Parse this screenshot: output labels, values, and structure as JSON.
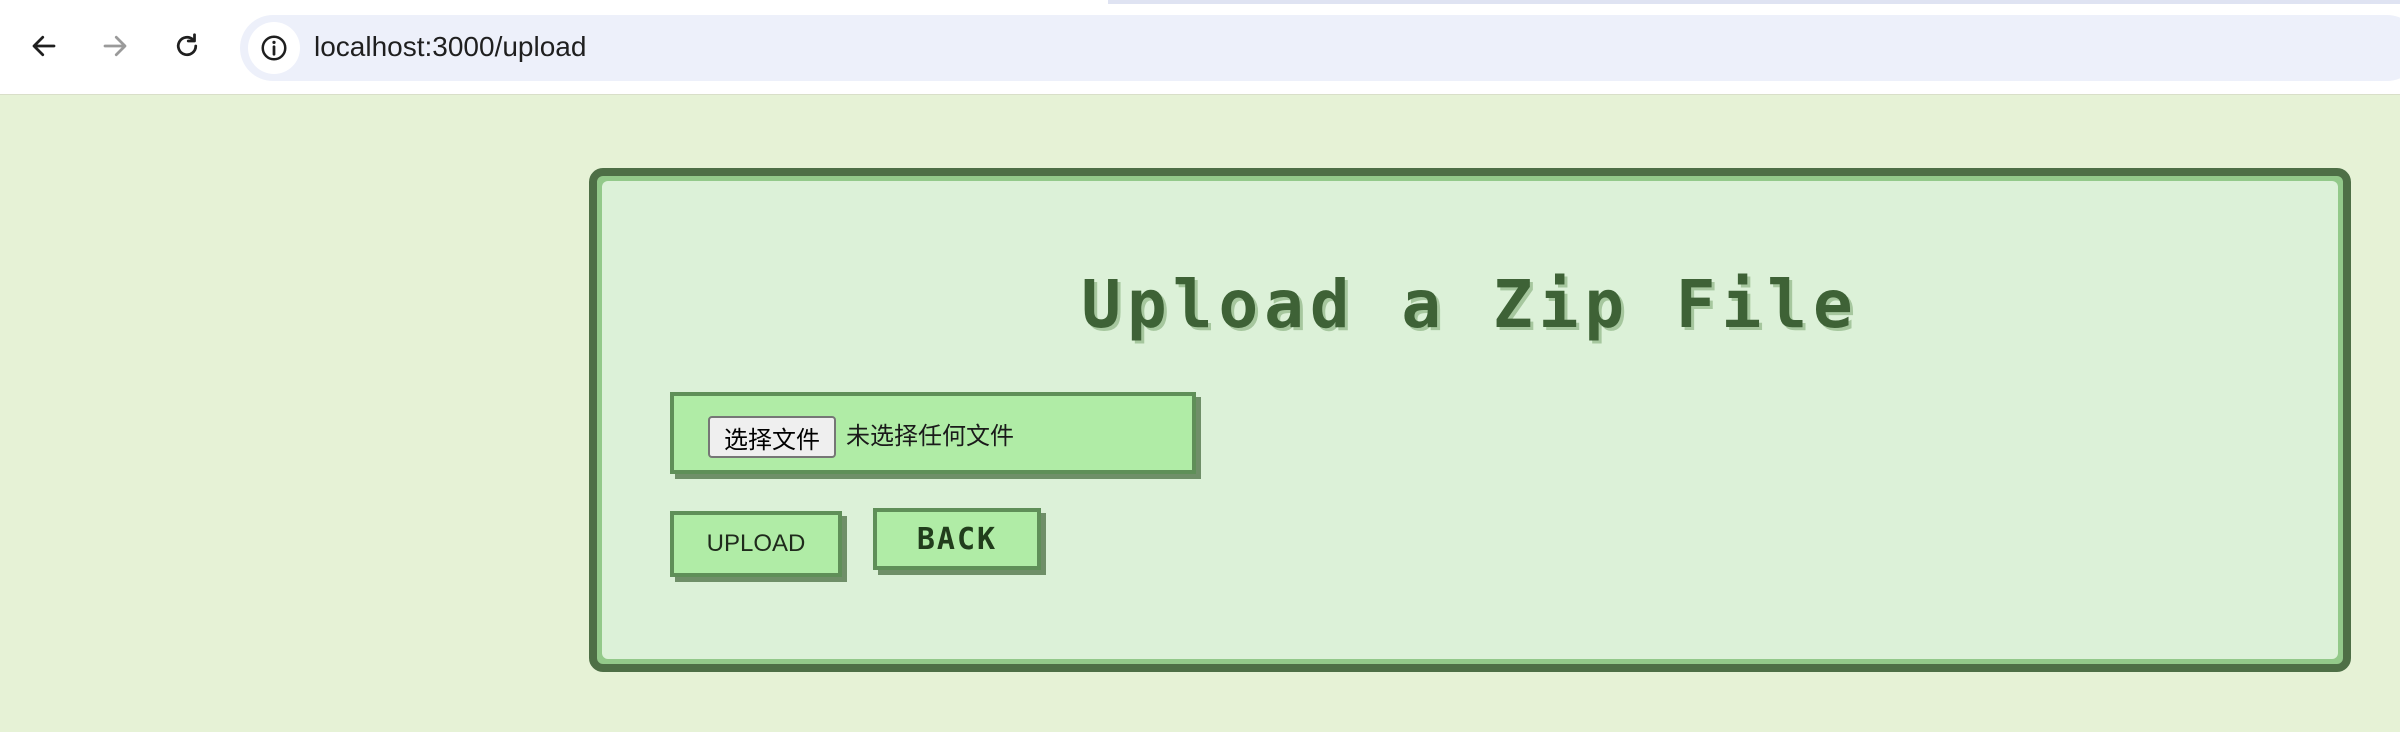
{
  "browser": {
    "url": "localhost:3000/upload",
    "icons": {
      "back": "arrow-left-icon",
      "forward": "arrow-right-icon",
      "reload": "reload-icon",
      "site_info": "info-icon"
    }
  },
  "upload_card": {
    "title": "Upload a Zip File",
    "file_input": {
      "button_label": "选择文件",
      "status_text": "未选择任何文件"
    },
    "upload_button": "UPLOAD",
    "back_button": "BACK"
  },
  "colors": {
    "page_background": "#e6f2d6",
    "card_border": "#4e6f46",
    "card_fill": "#dcf1d8",
    "button_fill": "#b0eca6",
    "title_text": "#3e6236"
  }
}
